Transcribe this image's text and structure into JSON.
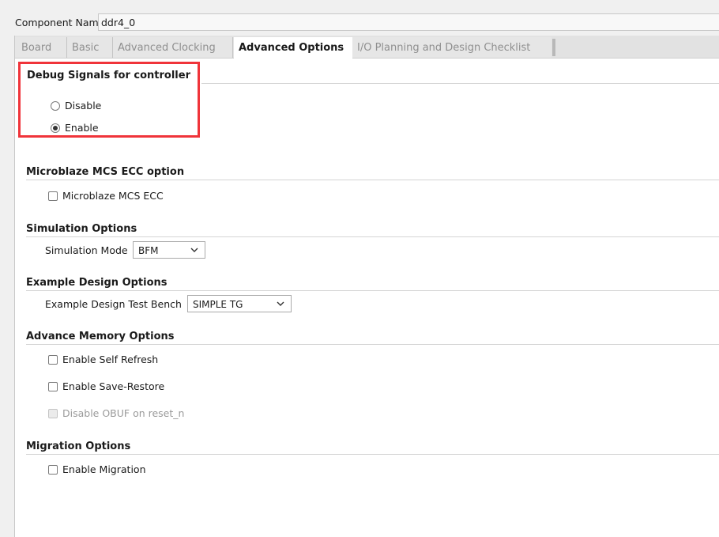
{
  "component": {
    "label": "Component Name",
    "value": "ddr4_0"
  },
  "tabs": [
    {
      "label": "Board",
      "active": false
    },
    {
      "label": "Basic",
      "active": false
    },
    {
      "label": "Advanced Clocking",
      "active": false
    },
    {
      "label": "Advanced Options",
      "active": true
    },
    {
      "label": "I/O Planning and Design Checklist",
      "active": false
    }
  ],
  "debug": {
    "title": "Debug Signals for controller",
    "options": [
      {
        "label": "Disable",
        "selected": false
      },
      {
        "label": "Enable",
        "selected": true
      }
    ]
  },
  "microblaze": {
    "title": "Microblaze MCS ECC option",
    "checkbox_label": "Microblaze MCS ECC",
    "checked": false
  },
  "simulation": {
    "title": "Simulation Options",
    "mode_label": "Simulation Mode",
    "mode_value": "BFM"
  },
  "example": {
    "title": "Example Design Options",
    "bench_label": "Example Design Test Bench",
    "bench_value": "SIMPLE TG"
  },
  "advance_memory": {
    "title": "Advance Memory Options",
    "self_refresh": "Enable Self Refresh",
    "save_restore": "Enable Save-Restore",
    "disable_obuf": "Disable OBUF on reset_n"
  },
  "migration": {
    "title": "Migration Options",
    "enable_label": "Enable Migration"
  },
  "colors": {
    "highlight": "#f0343a",
    "panel_bg": "#ffffff",
    "window_bg": "#f0f0f0"
  }
}
